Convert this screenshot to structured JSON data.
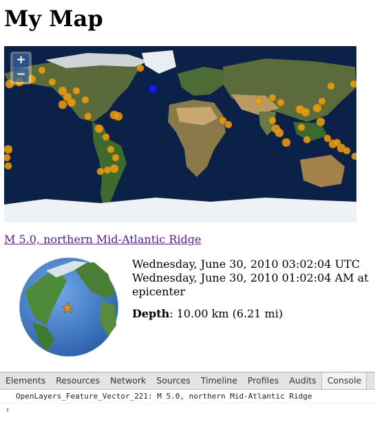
{
  "page": {
    "title": "My Map"
  },
  "map": {
    "zoom_in_label": "+",
    "zoom_out_label": "−",
    "colors": {
      "ocean": "#0a1d3e",
      "marker": "#f0a010",
      "selected": "#1020e0"
    }
  },
  "feature": {
    "title": "M 5.0, northern Mid-Atlantic Ridge",
    "utc_time": "Wednesday, June 30, 2010 03:02:04 UTC",
    "local_time": "Wednesday, June 30, 2010 01:02:04 AM at epicenter",
    "depth_label": "Depth",
    "depth_value": ": 10.00 km (6.21 mi)"
  },
  "devtools": {
    "tabs": [
      "Elements",
      "Resources",
      "Network",
      "Sources",
      "Timeline",
      "Profiles",
      "Audits",
      "Console"
    ],
    "active_tab": "Console",
    "console_output": "OpenLayers_Feature_Vector_221: M 5.0, northern Mid-Atlantic Ridge",
    "prompt_symbol": "›"
  }
}
